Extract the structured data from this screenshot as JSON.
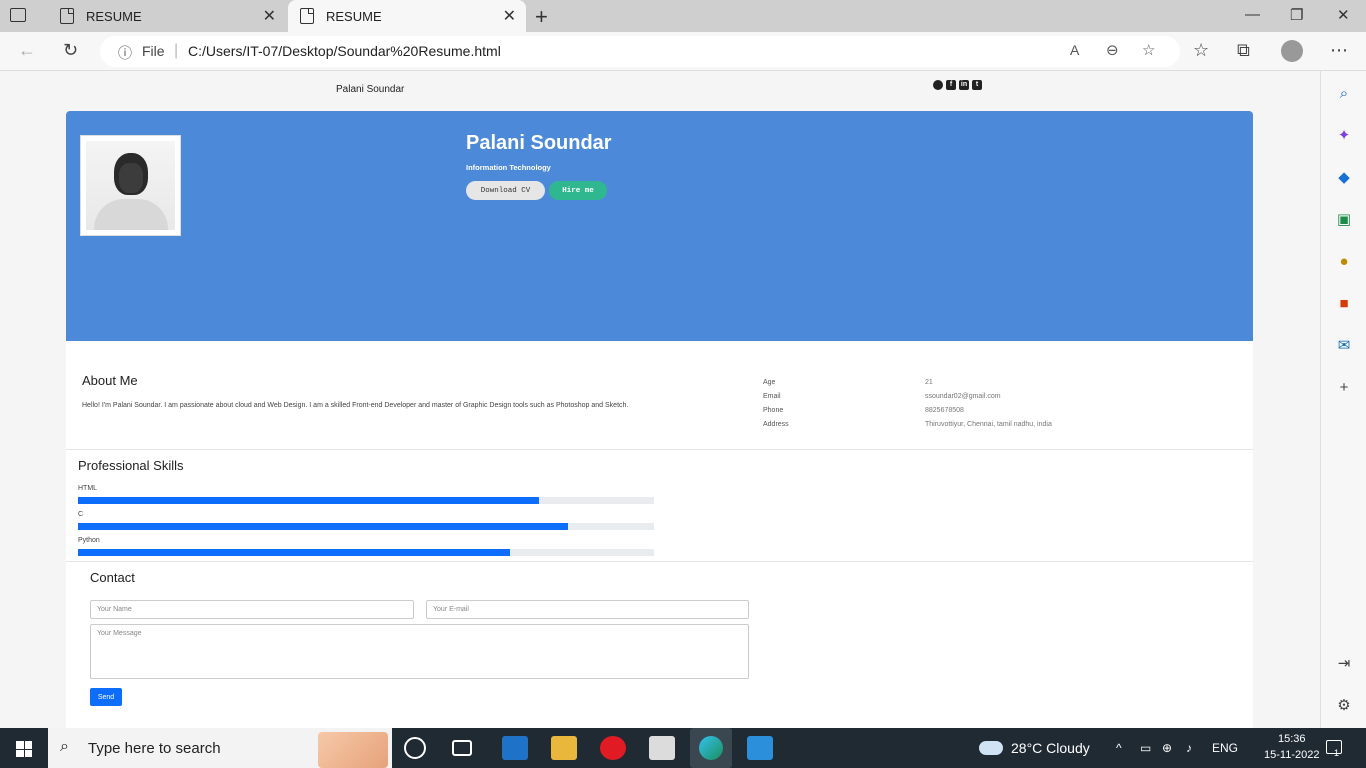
{
  "browser": {
    "tabs": [
      {
        "label": "RESUME"
      },
      {
        "label": "RESUME"
      }
    ],
    "url_prefix": "File",
    "url": "C:/Users/IT-07/Desktop/Soundar%20Resume.html"
  },
  "nav": {
    "brand": "Palani Soundar",
    "social": [
      "github-icon",
      "facebook-icon",
      "linkedin-icon",
      "twitter-icon"
    ]
  },
  "hero": {
    "name": "Palani Soundar",
    "title": "Information Technology",
    "download_label": "Download CV",
    "hire_label": "Hire me"
  },
  "about": {
    "heading": "About Me",
    "text": "Hello! I'm Palani Soundar. I am passionate about cloud and Web Design. I am a skilled Front-end Developer and master of Graphic Design tools such as Photoshop and Sketch.",
    "info": [
      {
        "key": "Age",
        "value": "21"
      },
      {
        "key": "Email",
        "value": "ssoundar02@gmail.com"
      },
      {
        "key": "Phone",
        "value": "8825678508"
      },
      {
        "key": "Address",
        "value": "Thiruvottiyur, Chennai, tamil nadhu, india"
      }
    ]
  },
  "skills": {
    "heading": "Professional Skills",
    "items": [
      {
        "name": "HTML",
        "level": 0.8
      },
      {
        "name": "C",
        "level": 0.85
      },
      {
        "name": "Python",
        "level": 0.75
      }
    ]
  },
  "contact": {
    "heading": "Contact",
    "name_placeholder": "Your Name",
    "email_placeholder": "Your E-mail",
    "message_placeholder": "Your Message",
    "send_label": "Send"
  },
  "taskbar": {
    "search_placeholder": "Type here to search",
    "weather": "28°C  Cloudy",
    "lang": "ENG",
    "time": "15:36",
    "date": "15-11-2022",
    "notification_count": "1"
  },
  "colors": {
    "hero_bg": "#4d89d9",
    "hire_btn": "#2fb88f",
    "primary": "#0d6efd"
  }
}
